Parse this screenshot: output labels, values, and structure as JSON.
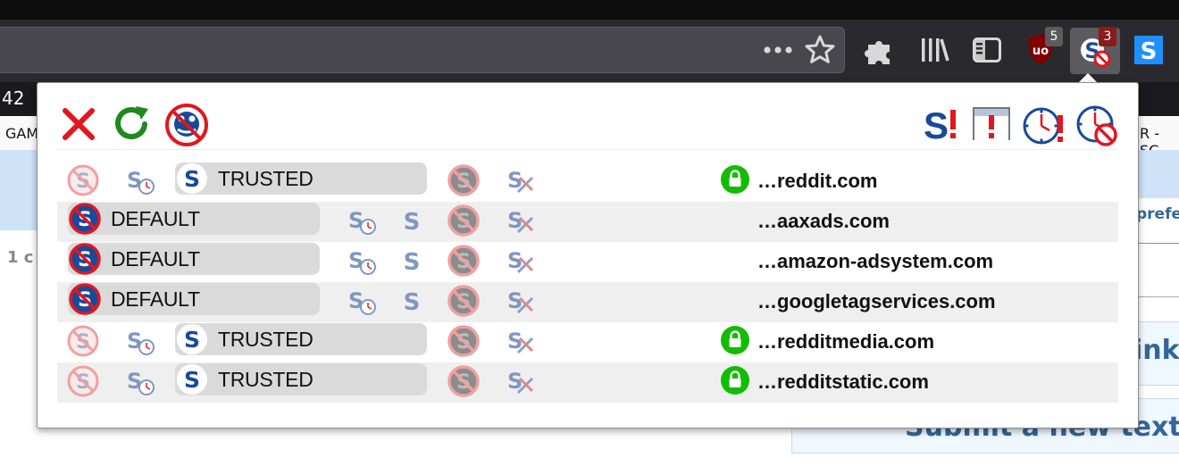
{
  "colors": {
    "chrome_dark": "#2a2a2e",
    "urlbar": "#47474d",
    "ublock_red": "#800000",
    "noscript_blue": "#184a9a",
    "reddit_blue": "#cee3f8",
    "popup_row_alt": "#efefef",
    "pill_gray": "#dadada",
    "lock_green": "#12bc00",
    "danger_red": "#e0171f"
  },
  "toolbar": {
    "icons": [
      "more-actions-icon",
      "bookmark-star-icon",
      "extensions-puzzle-icon",
      "library-icon",
      "sidebar-icon",
      "ublock-icon",
      "noscript-icon",
      "noscript-blue-s-icon"
    ],
    "ublock_badge": "5",
    "noscript_badge": "3"
  },
  "background_page": {
    "tab_fragment_left": "42",
    "bookmark_fragment_left": "GAM",
    "bookmark_fragment_right": "R - SC",
    "link_fragment_pref": "prefe",
    "count_fragment": "1 c",
    "bold_fragment_link": "ink",
    "bold_fragment_submit": "Submit a new text p"
  },
  "popup": {
    "header_left_icons": [
      "close-icon",
      "reload-icon",
      "disable-restrictions-icon"
    ],
    "header_right_icons": [
      "noscript-options-icon",
      "temporary-allow-page-icon",
      "temp-trust-all-icon",
      "revoke-temp-icon"
    ],
    "rows": [
      {
        "level": "TRUSTED",
        "domain": "…reddit.com",
        "secure": true
      },
      {
        "level": "DEFAULT",
        "domain": "…aaxads.com",
        "secure": false
      },
      {
        "level": "DEFAULT",
        "domain": "…amazon-adsystem.com",
        "secure": false
      },
      {
        "level": "DEFAULT",
        "domain": "…googletagservices.com",
        "secure": false
      },
      {
        "level": "TRUSTED",
        "domain": "…redditmedia.com",
        "secure": true
      },
      {
        "level": "TRUSTED",
        "domain": "…redditstatic.com",
        "secure": true
      }
    ]
  }
}
